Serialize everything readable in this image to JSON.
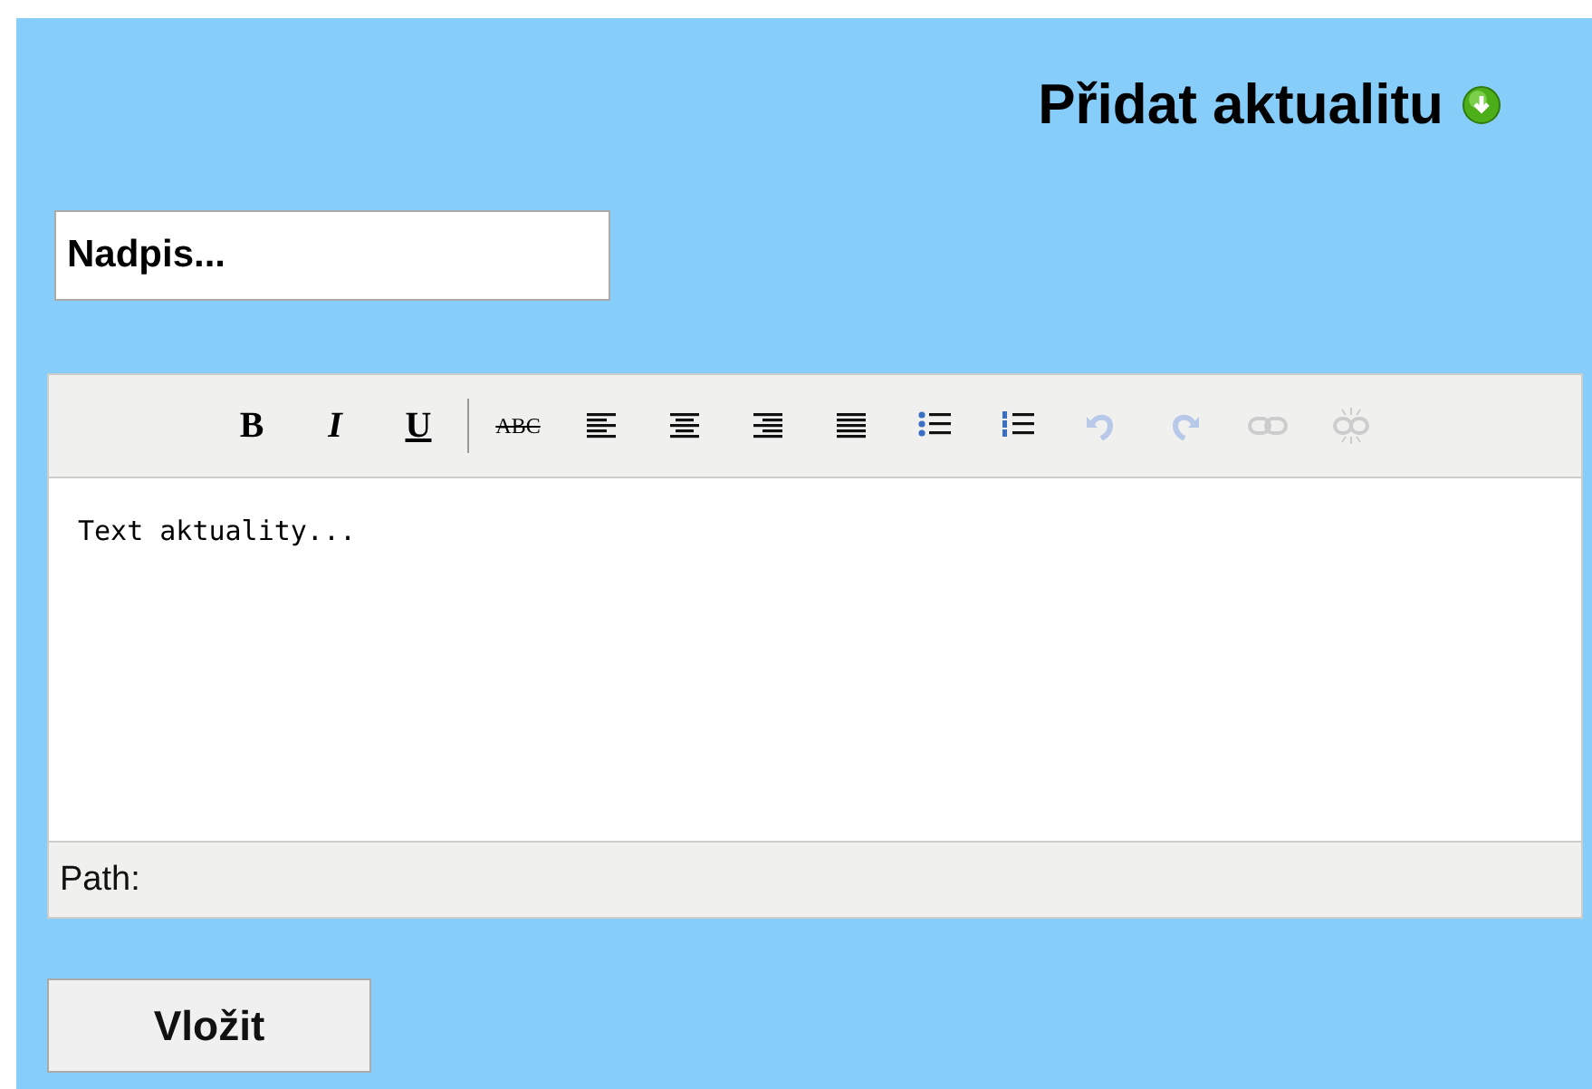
{
  "heading": "Přidat aktualitu",
  "title_field": {
    "value": "Nadpis..."
  },
  "editor": {
    "toolbar": [
      {
        "kind": "bold",
        "label": "B",
        "disabled": false
      },
      {
        "kind": "italic",
        "label": "I",
        "disabled": false
      },
      {
        "kind": "underline",
        "label": "U",
        "disabled": false
      },
      {
        "kind": "separator"
      },
      {
        "kind": "strike",
        "label": "ABC",
        "disabled": false
      },
      {
        "kind": "align-left",
        "disabled": false
      },
      {
        "kind": "align-center",
        "disabled": false
      },
      {
        "kind": "align-right",
        "disabled": false
      },
      {
        "kind": "align-justify",
        "disabled": false
      },
      {
        "kind": "bullets",
        "disabled": false
      },
      {
        "kind": "numbers",
        "disabled": false
      },
      {
        "kind": "undo",
        "disabled": true
      },
      {
        "kind": "redo",
        "disabled": true
      },
      {
        "kind": "link",
        "disabled": true
      },
      {
        "kind": "unlink",
        "disabled": true
      }
    ],
    "content": "Text aktuality...",
    "path_label": "Path:"
  },
  "submit": "Vložit"
}
